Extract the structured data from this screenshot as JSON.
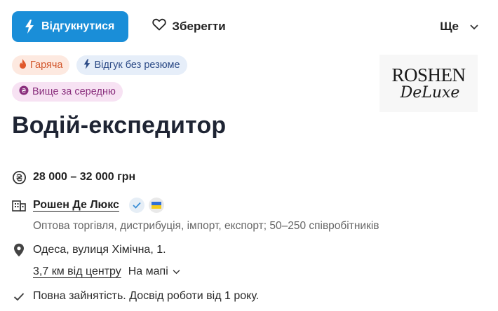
{
  "actions": {
    "apply_label": "Відгукнутися",
    "save_label": "Зберегти",
    "more_label": "Ще"
  },
  "tags": {
    "hot": "Гаряча",
    "no_resume": "Відгук без резюме",
    "above_avg": "Вище за середню"
  },
  "logo": {
    "main": "ROSHEN",
    "sub": "DeLuxe"
  },
  "job_title": "Водій-експедитор",
  "salary": "28 000 – 32 000 грн",
  "company": {
    "name": "Рошен Де Люкс",
    "description": "Оптова торгівля, дистрибуція, імпорт, експорт; 50–250 співробітників"
  },
  "location": {
    "address": "Одеса, вулиця Хімічна, 1.",
    "distance": "3,7 км від центру",
    "map_label": "На мапі"
  },
  "employment": "Повна зайнятість. Досвід роботи від 1 року.",
  "colors": {
    "accent": "#1a8ed8",
    "hot_tag": "#fde9e0",
    "no_resume_tag": "#e6eef9",
    "salary_tag": "#f7e2f3"
  }
}
